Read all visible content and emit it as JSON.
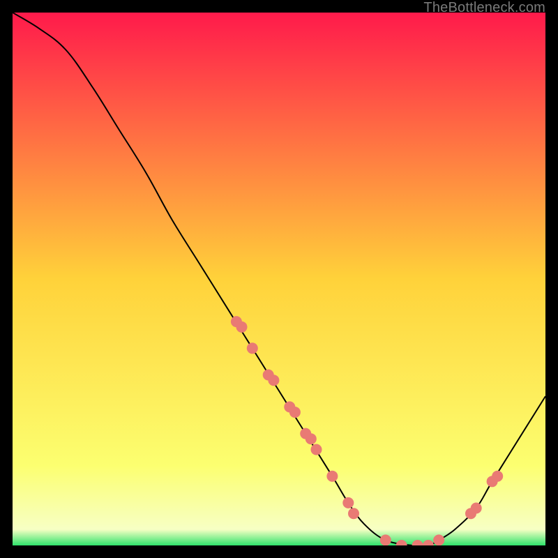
{
  "attribution": "TheBottleneck.com",
  "chart_data": {
    "type": "line",
    "title": "",
    "xlabel": "",
    "ylabel": "",
    "x": [
      0.0,
      0.05,
      0.1,
      0.15,
      0.2,
      0.25,
      0.3,
      0.35,
      0.4,
      0.45,
      0.5,
      0.55,
      0.6,
      0.63,
      0.66,
      0.7,
      0.75,
      0.78,
      0.8,
      0.83,
      0.87,
      0.9,
      0.95,
      1.0
    ],
    "y": [
      1.0,
      0.97,
      0.93,
      0.86,
      0.78,
      0.7,
      0.61,
      0.53,
      0.45,
      0.37,
      0.29,
      0.21,
      0.13,
      0.08,
      0.04,
      0.01,
      0.0,
      0.0,
      0.01,
      0.03,
      0.07,
      0.12,
      0.2,
      0.28
    ],
    "curve_markers_x": [
      0.42,
      0.43,
      0.45,
      0.48,
      0.49,
      0.52,
      0.53,
      0.55,
      0.56,
      0.57,
      0.6,
      0.63,
      0.64,
      0.7,
      0.73,
      0.76,
      0.78,
      0.8,
      0.86,
      0.87,
      0.9,
      0.91
    ],
    "curve_markers_y": [
      0.42,
      0.41,
      0.37,
      0.32,
      0.31,
      0.26,
      0.25,
      0.21,
      0.2,
      0.18,
      0.13,
      0.08,
      0.06,
      0.01,
      0.0,
      0.0,
      0.0,
      0.01,
      0.06,
      0.07,
      0.12,
      0.13
    ],
    "green_band_y_range": [
      0.0,
      0.03
    ],
    "gradient_stops": [
      {
        "offset": 0.0,
        "color": "#ff1a4b"
      },
      {
        "offset": 0.5,
        "color": "#ffd23a"
      },
      {
        "offset": 0.85,
        "color": "#fcff70"
      },
      {
        "offset": 0.97,
        "color": "#f7ffc4"
      },
      {
        "offset": 1.0,
        "color": "#2fe36b"
      }
    ],
    "xlim": [
      0,
      1
    ],
    "ylim": [
      0,
      1
    ]
  },
  "colors": {
    "marker": "#e97a74",
    "curve": "#000000",
    "background": "#000000"
  }
}
